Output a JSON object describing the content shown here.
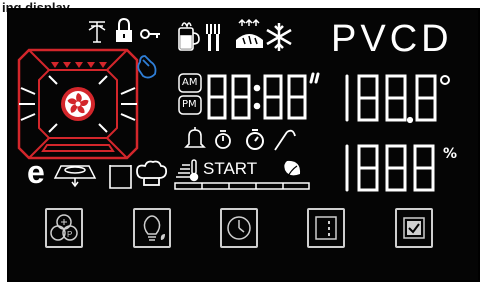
{
  "title": "ing display",
  "display": {
    "brand_letters": "PVCD",
    "clock": {
      "am": "AM",
      "pm": "PM",
      "value": "88:88",
      "seconds_mark": "''"
    },
    "temperature": {
      "value": "188.8",
      "unit": "°"
    },
    "percentage": {
      "value": "1888",
      "unit": "%"
    },
    "start_label": "START",
    "eco_letter": "e"
  },
  "icons": {
    "top_row": [
      "antenna-icon",
      "lock-icon",
      "key-icon",
      "beverage-icon",
      "utensils-icon",
      "bread-icon",
      "snowflake-icon"
    ],
    "middle": [
      "bell-icon",
      "timer-icon",
      "timer-icon",
      "probe-icon"
    ],
    "left": [
      "eco-icon",
      "pizza-icon",
      "tray-icon",
      "chef-hat-icon"
    ]
  },
  "buttons": [
    {
      "name": "program-button",
      "icon": "snow-program-icon"
    },
    {
      "name": "light-button",
      "icon": "bulb-icon"
    },
    {
      "name": "clock-button",
      "icon": "clock-icon"
    },
    {
      "name": "door-button",
      "icon": "door-icon"
    },
    {
      "name": "confirm-button",
      "icon": "check-icon"
    }
  ],
  "colors": {
    "background": "#050505",
    "segment": "#ffffff",
    "accent_red": "#d3262b",
    "accent_blue": "#2f7fd8"
  }
}
